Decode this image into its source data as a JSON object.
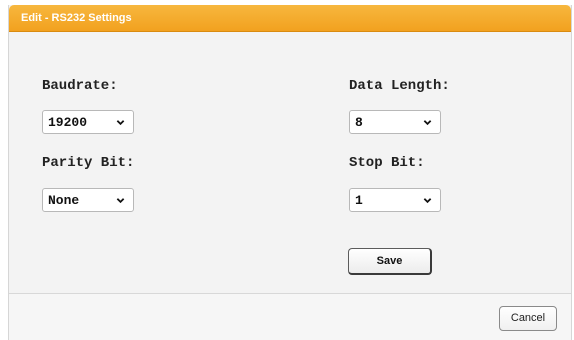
{
  "dialog": {
    "title": "Edit - RS232 Settings"
  },
  "fields": {
    "baudrate": {
      "label": "Baudrate:",
      "value": "19200"
    },
    "data_length": {
      "label": "Data Length:",
      "value": "8"
    },
    "parity_bit": {
      "label": "Parity Bit:",
      "value": "None"
    },
    "stop_bit": {
      "label": "Stop Bit:",
      "value": "1"
    }
  },
  "actions": {
    "save_label": "Save",
    "cancel_label": "Cancel"
  },
  "colors": {
    "titlebar": "#f2a11f",
    "dialog_bg": "#f3f3f3"
  }
}
